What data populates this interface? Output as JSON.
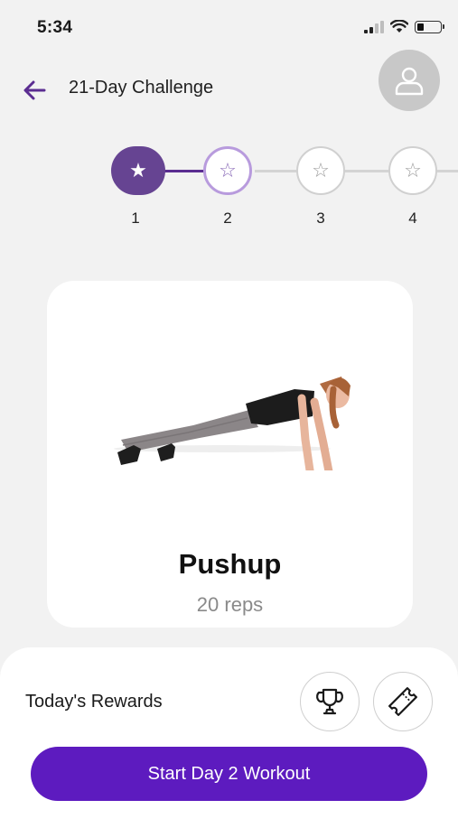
{
  "status_bar": {
    "time": "5:34",
    "battery_level": 0.3
  },
  "header": {
    "title": "21-Day Challenge"
  },
  "stepper": {
    "steps": [
      {
        "number": "1",
        "state": "done",
        "icon": "star-filled-icon"
      },
      {
        "number": "2",
        "state": "current",
        "icon": "star-outline-icon"
      },
      {
        "number": "3",
        "state": "locked",
        "icon": "star-outline-icon"
      },
      {
        "number": "4",
        "state": "locked",
        "icon": "star-outline-icon"
      }
    ]
  },
  "exercise": {
    "name": "Pushup",
    "reps": "20 reps"
  },
  "rewards": {
    "label": "Today's Rewards",
    "icons": [
      "trophy-icon",
      "ticket-icon"
    ]
  },
  "cta": {
    "label": "Start Day 2 Workout"
  },
  "colors": {
    "accent": "#5d1bbf",
    "step_done": "#664492",
    "step_current_border": "#b89bdd"
  }
}
